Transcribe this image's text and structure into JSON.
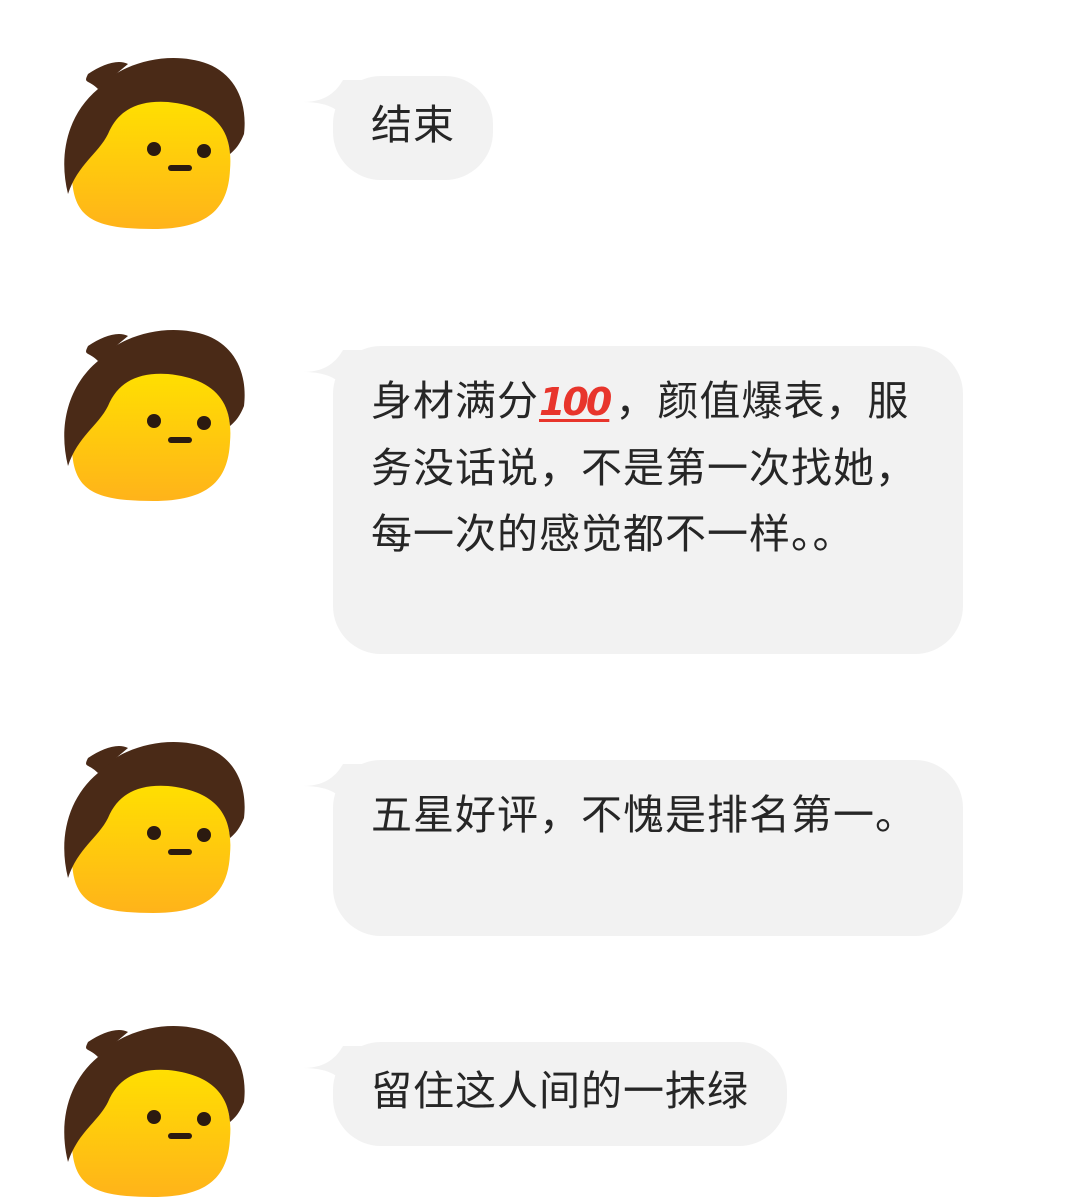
{
  "messages": [
    {
      "avatar_icon": "emoji-face-avatar-icon",
      "text": "结束"
    },
    {
      "avatar_icon": "emoji-face-avatar-icon",
      "text_before_emoji": "身材满分",
      "emoji": "💯",
      "emoji_name": "hundred-points-icon",
      "text_after_emoji": "，颜值爆表，服务没话说，不是第一次找她，每一次的感觉都不一样。。"
    },
    {
      "avatar_icon": "emoji-face-avatar-icon",
      "text": "五星好评，不愧是排名第一。"
    },
    {
      "avatar_icon": "emoji-face-avatar-icon",
      "text": "留住这人间的一抹绿"
    }
  ],
  "colors": {
    "bubble_bg": "#f2f2f2",
    "text": "#262626",
    "face_yellow": "#ffd500",
    "face_orange": "#ffb31a",
    "hair": "#4a2a17",
    "page_bg": "#ffffff"
  }
}
